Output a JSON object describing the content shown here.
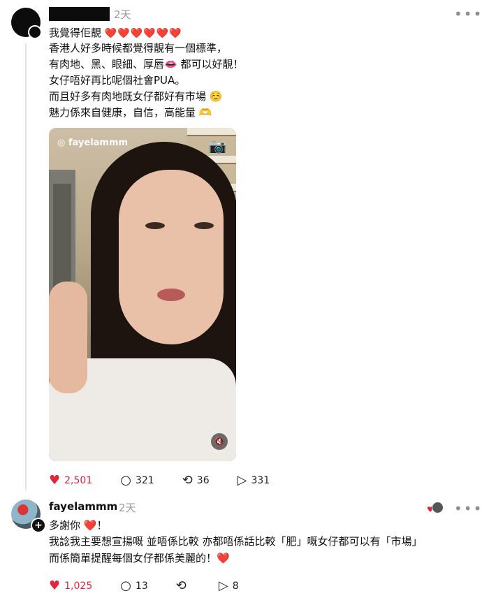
{
  "post": {
    "time": "2天",
    "lines": [
      "我覺得佢靚",
      "香港人好多時候都覺得靚有一個標準，",
      "有肉地、黑、眼細、厚唇👄 都可以好靚！",
      "女仔唔好再比呢個社會PUA。",
      "而且好多有肉地既女仔都好有市場 ☺️",
      "魅力係來自健康，自信，高能量 🫶"
    ],
    "hearts_suffix": "❤️❤️❤️❤️❤️❤️",
    "video": {
      "tag": "fayelammm"
    },
    "actions": {
      "likes": "2,501",
      "comments": "321",
      "reposts": "36",
      "shares": "331"
    }
  },
  "reply": {
    "username": "fayelammm",
    "time": "2天",
    "lines": [
      "多謝你 ❤️！",
      "我諗我主要想宣揚嘅 並唔係比較 亦都唔係話比較「肥」嘅女仔都可以有「市場」",
      "而係簡單提醒每個女仔都係美麗的！❤️"
    ],
    "actions": {
      "likes": "1,025",
      "comments": "13",
      "reposts": "",
      "shares": "8"
    }
  },
  "icons": {
    "more": "more-icon",
    "heart": "heart-icon",
    "comment": "comment-icon",
    "repost": "repost-icon",
    "share": "share-icon",
    "camera": "camera-icon",
    "mute": "mute-icon",
    "instagram": "instagram-icon"
  },
  "colors": {
    "like": "#e3243b",
    "muted": "#9a9a9a",
    "thread_line": "#e3e3e3"
  }
}
